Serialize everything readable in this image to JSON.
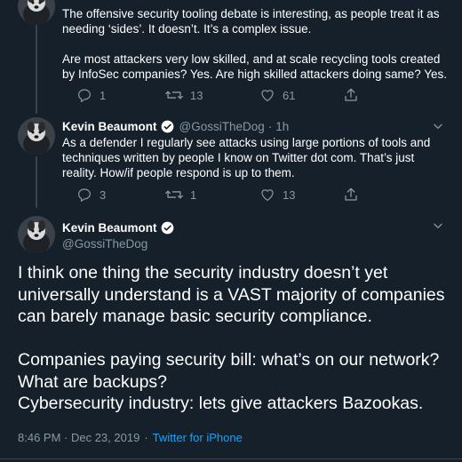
{
  "tweet1": {
    "paragraph1": "The offensive security tooling debate is interesting, as people treat it as needing ‘sides’. It doesn’t. It’s a complex issue.",
    "paragraph2": "Are most attackers very low skilled, and at scale recycling tools created by InfoSec companies? Yes. Are high skilled attackers doing same? Yes.",
    "replies": "1",
    "retweets": "13",
    "likes": "61"
  },
  "tweet2": {
    "name": "Kevin Beaumont",
    "handle": "@GossiTheDog",
    "separator": "·",
    "time": "1h",
    "text": "As a defender I regularly see attacks using large portions of tools and techniques written by people I know on Twitter dot com. That’s just reality. How/if people respond is up to them.",
    "replies": "3",
    "retweets": "1",
    "likes": "13"
  },
  "main_tweet": {
    "name": "Kevin Beaumont",
    "handle": "@GossiTheDog",
    "line1": "I think one thing the security industry doesn’t yet universally understand is a VAST majority of companies can barely manage basic security compliance.",
    "line2": "Companies paying security bill: what’s on our network? What are backups?",
    "line3": "Cybersecurity industry: lets give attackers Bazookas.",
    "timestamp": "8:46 PM · Dec 23, 2019",
    "separator": "·",
    "source": "Twitter for iPhone"
  },
  "colors": {
    "background": "#15202b",
    "muted": "#8899a6",
    "accent": "#1da1f2",
    "border": "#38444d"
  },
  "icons": [
    "avatar",
    "verified-badge-icon",
    "chevron-down-icon",
    "reply-icon",
    "retweet-icon",
    "like-icon",
    "share-icon"
  ]
}
